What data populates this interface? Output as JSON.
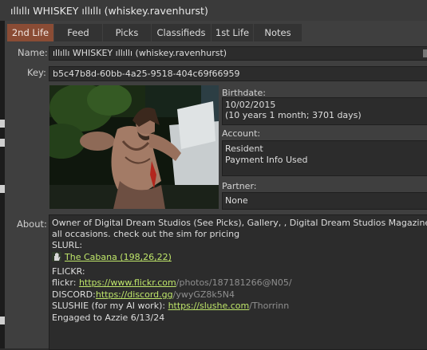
{
  "window": {
    "title": "ıllıllı WHISKEY  ıllıllı (whiskey.ravenhurst)"
  },
  "tabs": [
    {
      "label": "2nd Life",
      "active": true
    },
    {
      "label": "Feed"
    },
    {
      "label": "Picks"
    },
    {
      "label": "Classifieds"
    },
    {
      "label": "1st Life"
    },
    {
      "label": "Notes"
    }
  ],
  "profile": {
    "name_label": "Name:",
    "name_value": "ıllıllı WHISKEY  ıllıllı (whiskey.ravenhurst)",
    "key_label": "Key:",
    "key_value": "b5c47b8d-60bb-4a25-9518-404c69f66959",
    "birthdate_label": "Birthdate:",
    "birthdate_value": "10/02/2015",
    "birthdate_age": "(10 years 1 month; 3701 days)",
    "account_label": "Account:",
    "account_type": "Resident",
    "account_payment": "Payment Info Used",
    "partner_label": "Partner:",
    "partner_value": "None",
    "about_label": "About:"
  },
  "about": {
    "line1": "Owner of Digital Dream Studios  (See Picks), Gallery, , Digital Dream Studios Magazine H",
    "line2": "all occasions. check out the sim for pricing",
    "slurl_label": "SLURL:",
    "slurl_link": "The Cabana (198,26,22)",
    "flickr_heading": "FLICKR:",
    "flickr_prefix": "flickr: ",
    "flickr_link": "https://www.flickr.com",
    "flickr_rest": "/photos/187181266@N05/",
    "discord_prefix": "DISCORD:",
    "discord_link": "https://discord.gg",
    "discord_rest": "/ywyGZ8k5N4",
    "slushie_prefix": "SLUSHIE (for my AI work):  ",
    "slushie_link": "https://slushe.com",
    "slushie_rest": "/Thorrinn",
    "engaged": "Engaged to Azzie 6/13/24"
  },
  "colors": {
    "active_tab": "#8a4c35",
    "link": "#bfe66a",
    "panel": "#3f3f3f",
    "field": "#2c2c2c"
  },
  "icons": {
    "slurl": "hand-icon"
  }
}
